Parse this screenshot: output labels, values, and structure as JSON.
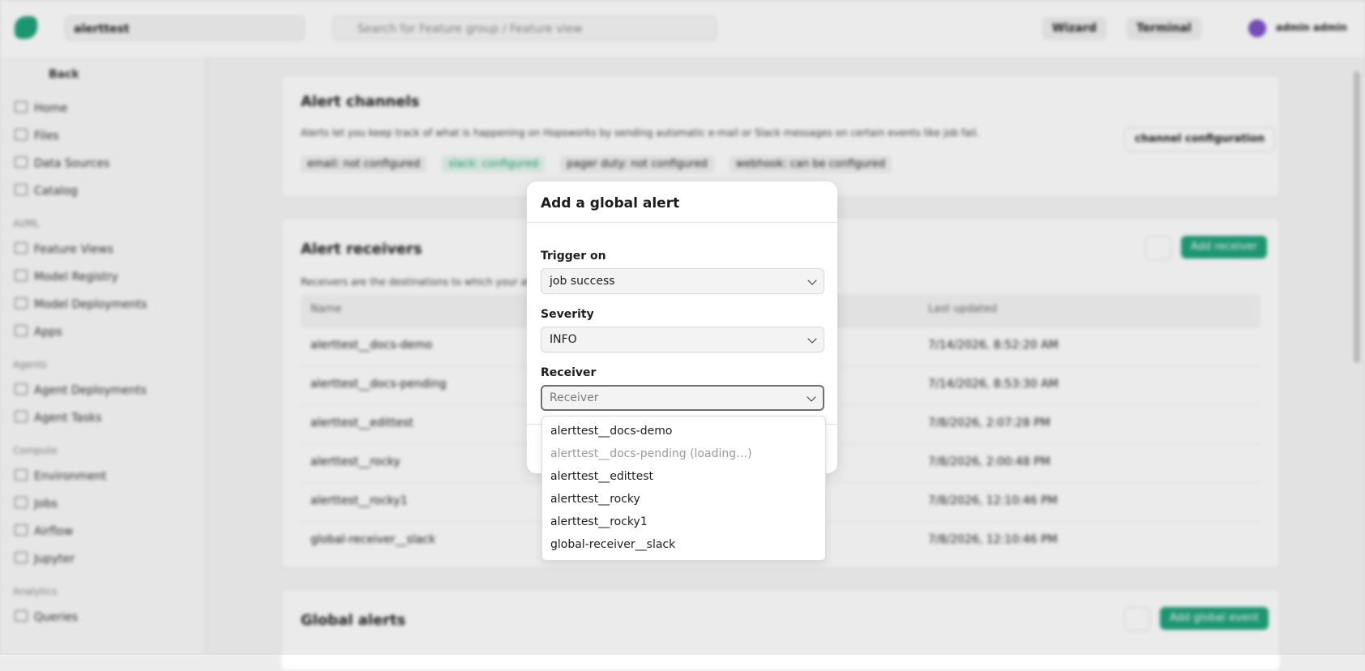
{
  "background": {
    "project_selector": "alerttest",
    "search_placeholder": "Search for Feature group / Feature view",
    "wizard_label": "Wizard",
    "terminal_label": "Terminal",
    "user_name": "admin admin",
    "back_label": "Back",
    "sidebar": {
      "items_top": [
        "Home",
        "Files",
        "Data Sources",
        "Catalog"
      ],
      "section_ai": "AI/ML",
      "items_ai": [
        "Feature Views",
        "Model Registry",
        "Model Deployments",
        "Apps"
      ],
      "section_agents": "Agents",
      "items_agents": [
        "Agent Deployments",
        "Agent Tasks"
      ],
      "section_compute": "Compute",
      "items_compute": [
        "Environment",
        "Jobs",
        "Airflow",
        "Jupyter"
      ],
      "section_analytics": "Analytics",
      "items_analytics": [
        "Queries"
      ]
    },
    "alert_channels": {
      "title": "Alert channels",
      "description": "Alerts let you keep track of what is happening on Hopsworks by sending automatic e-mail or Slack messages on certain events like job fail.",
      "channel_button": "channel configuration",
      "pills": [
        "email: not configured",
        "slack: configured",
        "pager duty: not configured",
        "webhook: can be configured"
      ]
    },
    "alert_receivers": {
      "title": "Alert receivers",
      "description": "Receivers are the destinations to which your alerts are sent.",
      "add_button": "Add receiver",
      "col_name": "Name",
      "col_updated": "Last updated",
      "rows": [
        {
          "name": "alerttest__docs-demo",
          "updated": "7/14/2026, 8:52:20 AM"
        },
        {
          "name": "alerttest__docs-pending",
          "updated": "7/14/2026, 8:53:30 AM"
        },
        {
          "name": "alerttest__edittest",
          "updated": "7/8/2026, 2:07:28 PM"
        },
        {
          "name": "alerttest__rocky",
          "updated": "7/8/2026, 2:00:48 PM"
        },
        {
          "name": "alerttest__rocky1",
          "updated": "7/8/2026, 12:10:46 PM"
        },
        {
          "name": "global-receiver__slack",
          "updated": "7/8/2026, 12:10:46 PM"
        }
      ]
    },
    "global_alerts": {
      "title": "Global alerts",
      "add_button": "Add global event"
    }
  },
  "modal": {
    "title": "Add a global alert",
    "trigger_label": "Trigger on",
    "trigger_value": "job success",
    "severity_label": "Severity",
    "severity_value": "INFO",
    "receiver_label": "Receiver",
    "receiver_placeholder": "Receiver"
  },
  "dropdown": {
    "options": [
      {
        "label": "alerttest__docs-demo",
        "disabled": false
      },
      {
        "label": "alerttest__docs-pending (loading…)",
        "disabled": true
      },
      {
        "label": "alerttest__edittest",
        "disabled": false
      },
      {
        "label": "alerttest__rocky",
        "disabled": false
      },
      {
        "label": "alerttest__rocky1",
        "disabled": false
      },
      {
        "label": "global-receiver__slack",
        "disabled": false
      }
    ]
  },
  "colors": {
    "accent": "#1fa37a",
    "avatar": "#7d52c7"
  }
}
